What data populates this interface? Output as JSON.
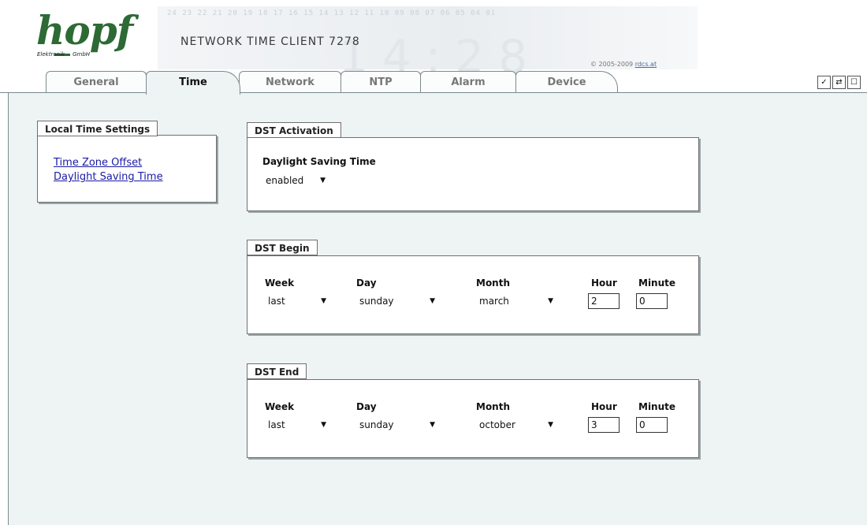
{
  "header": {
    "logo_text": "hopf",
    "logo_sub_left": "Elektronik",
    "logo_sub_right": "GmbH",
    "product_title": "NETWORK TIME CLIENT 7278",
    "copyright_prefix": "© 2005-2009 ",
    "copyright_link": "rdcs.at",
    "deco_digits": "24 23 22 21 20 19 18 17 16 15 14 13 12 11 10 09 08 07 06 05 04 01",
    "deco_big": "14:28"
  },
  "tabs": [
    {
      "label": "General",
      "active": false
    },
    {
      "label": "Time",
      "active": true
    },
    {
      "label": "Network",
      "active": false
    },
    {
      "label": "NTP",
      "active": false
    },
    {
      "label": "Alarm",
      "active": false
    },
    {
      "label": "Device",
      "active": false
    }
  ],
  "toolbar": {
    "apply_icon": "check-icon",
    "reload_icon": "refresh-icon",
    "save_icon": "square-icon",
    "apply_glyph": "✓",
    "reload_glyph": "⇄",
    "save_glyph": "☐"
  },
  "sidebar": {
    "title": "Local Time Settings",
    "links": [
      "Time Zone Offset",
      "Daylight Saving Time"
    ]
  },
  "dst_activation": {
    "title": "DST Activation",
    "field_label": "Daylight Saving Time",
    "value": "enabled"
  },
  "dst_begin": {
    "title": "DST Begin",
    "week_label": "Week",
    "week": "last",
    "day_label": "Day",
    "day": "sunday",
    "month_label": "Month",
    "month": "march",
    "hour_label": "Hour",
    "hour": "2",
    "minute_label": "Minute",
    "minute": "0"
  },
  "dst_end": {
    "title": "DST End",
    "week_label": "Week",
    "week": "last",
    "day_label": "Day",
    "day": "sunday",
    "month_label": "Month",
    "month": "october",
    "hour_label": "Hour",
    "hour": "3",
    "minute_label": "Minute",
    "minute": "0"
  },
  "colors": {
    "brand_green": "#2d6a35",
    "content_bg": "#eef4f3",
    "link": "#1a1aa6"
  }
}
